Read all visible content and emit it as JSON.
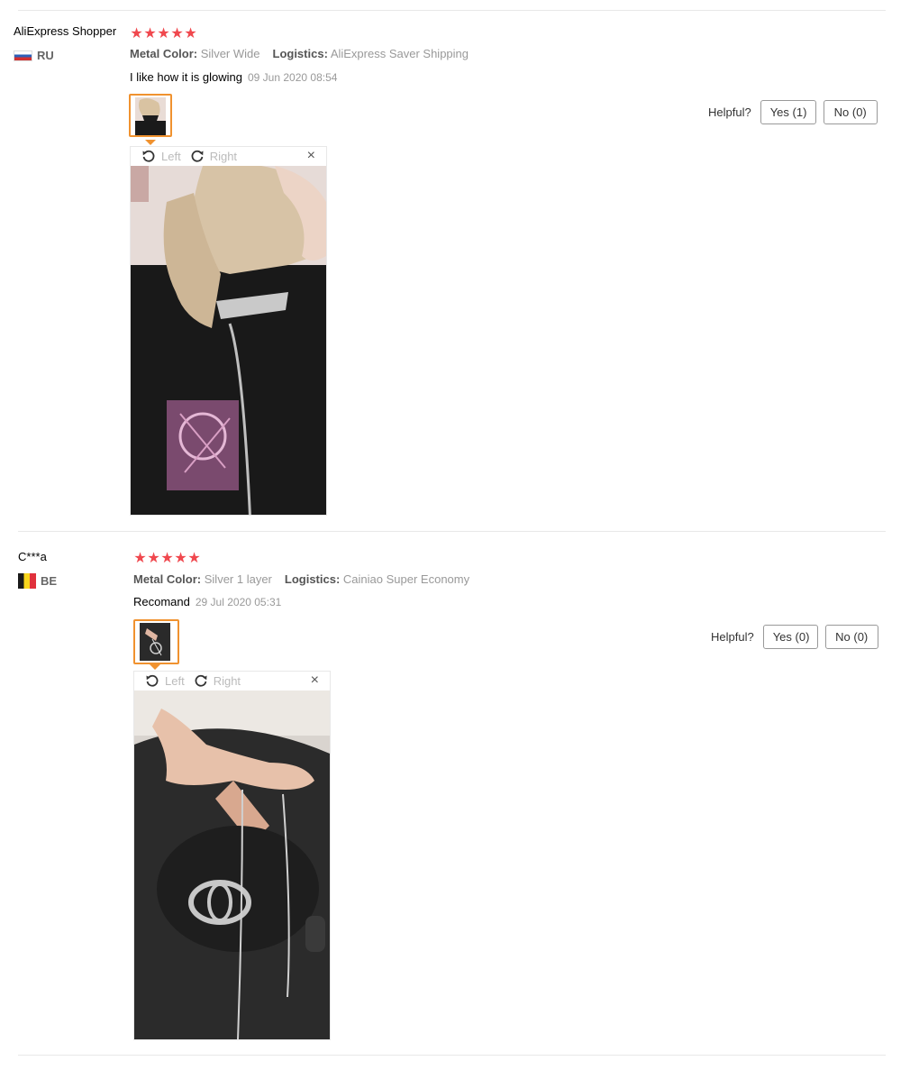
{
  "reviews": [
    {
      "user": "AliExpress Shopper",
      "country": "RU",
      "rating": 5,
      "metal_color_label": "Metal Color:",
      "metal_color_value": "Silver Wide",
      "logistics_label": "Logistics:",
      "logistics_value": "AliExpress Saver Shipping",
      "text": "I like how it is glowing",
      "date": "09 Jun 2020 08:54",
      "helpful_label": "Helpful?",
      "yes_label": "Yes (1)",
      "no_label": "No (0)",
      "viewer": {
        "left_label": "Left",
        "right_label": "Right",
        "close_symbol": "×"
      }
    },
    {
      "user": "C***a",
      "country": "BE",
      "rating": 5,
      "metal_color_label": "Metal Color:",
      "metal_color_value": "Silver 1 layer",
      "logistics_label": "Logistics:",
      "logistics_value": "Cainiao Super Economy",
      "text": "Recomand",
      "date": "29 Jul 2020 05:31",
      "helpful_label": "Helpful?",
      "yes_label": "Yes (0)",
      "no_label": "No (0)",
      "viewer": {
        "left_label": "Left",
        "right_label": "Right",
        "close_symbol": "×"
      }
    }
  ],
  "colors": {
    "star": "#f0484e",
    "thumb_border": "#f0922f",
    "separator": "#e8e8e8"
  },
  "icons": [
    "star-icon",
    "rotate-left-icon",
    "rotate-right-icon",
    "close-icon",
    "flag-ru-icon",
    "flag-be-icon"
  ]
}
